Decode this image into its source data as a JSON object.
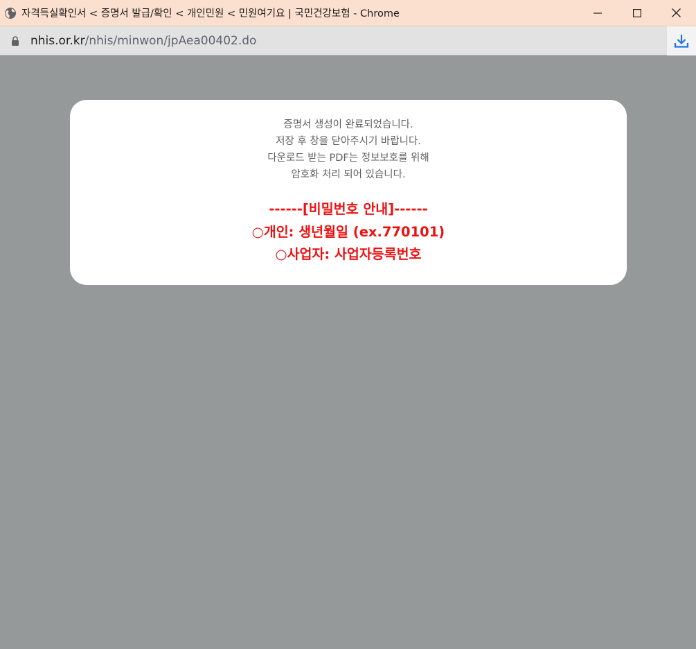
{
  "window": {
    "title": "자격득실확인서 < 증명서 발급/확인 < 개인민원 < 민원여기요 | 국민건강보험 - Chrome",
    "controls": {
      "minimize_icon": "minimize-icon",
      "maximize_icon": "maximize-icon",
      "close_icon": "close-icon"
    }
  },
  "address_bar": {
    "host": "nhis.or.kr",
    "path": "/nhis/minwon/jpAea00402.do"
  },
  "modal": {
    "messages": [
      "증명서 생성이 완료되었습니다.",
      "저장 후 창을 닫아주시기 바랍니다.",
      "다운로드 받는 PDF는 정보보호를 위해",
      "암호화 처리 되어 있습니다."
    ],
    "notice": {
      "header": "------[비밀번호 안내]------",
      "individual": "○개인: 생년월일 (ex.770101)",
      "business": "○사업자: 사업자등록번호"
    }
  },
  "colors": {
    "titlebar_bg": "#fce0cf",
    "page_bg": "#959999",
    "notice_red": "#ee1111",
    "download_blue": "#1a73e8"
  }
}
